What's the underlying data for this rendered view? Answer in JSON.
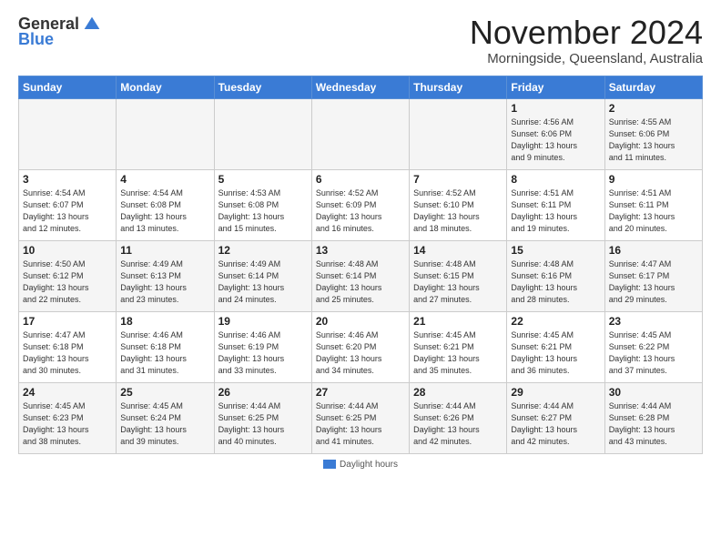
{
  "logo": {
    "general": "General",
    "blue": "Blue"
  },
  "title": "November 2024",
  "location": "Morningside, Queensland, Australia",
  "days_header": [
    "Sunday",
    "Monday",
    "Tuesday",
    "Wednesday",
    "Thursday",
    "Friday",
    "Saturday"
  ],
  "weeks": [
    [
      {
        "day": "",
        "info": ""
      },
      {
        "day": "",
        "info": ""
      },
      {
        "day": "",
        "info": ""
      },
      {
        "day": "",
        "info": ""
      },
      {
        "day": "",
        "info": ""
      },
      {
        "day": "1",
        "info": "Sunrise: 4:56 AM\nSunset: 6:06 PM\nDaylight: 13 hours\nand 9 minutes."
      },
      {
        "day": "2",
        "info": "Sunrise: 4:55 AM\nSunset: 6:06 PM\nDaylight: 13 hours\nand 11 minutes."
      }
    ],
    [
      {
        "day": "3",
        "info": "Sunrise: 4:54 AM\nSunset: 6:07 PM\nDaylight: 13 hours\nand 12 minutes."
      },
      {
        "day": "4",
        "info": "Sunrise: 4:54 AM\nSunset: 6:08 PM\nDaylight: 13 hours\nand 13 minutes."
      },
      {
        "day": "5",
        "info": "Sunrise: 4:53 AM\nSunset: 6:08 PM\nDaylight: 13 hours\nand 15 minutes."
      },
      {
        "day": "6",
        "info": "Sunrise: 4:52 AM\nSunset: 6:09 PM\nDaylight: 13 hours\nand 16 minutes."
      },
      {
        "day": "7",
        "info": "Sunrise: 4:52 AM\nSunset: 6:10 PM\nDaylight: 13 hours\nand 18 minutes."
      },
      {
        "day": "8",
        "info": "Sunrise: 4:51 AM\nSunset: 6:11 PM\nDaylight: 13 hours\nand 19 minutes."
      },
      {
        "day": "9",
        "info": "Sunrise: 4:51 AM\nSunset: 6:11 PM\nDaylight: 13 hours\nand 20 minutes."
      }
    ],
    [
      {
        "day": "10",
        "info": "Sunrise: 4:50 AM\nSunset: 6:12 PM\nDaylight: 13 hours\nand 22 minutes."
      },
      {
        "day": "11",
        "info": "Sunrise: 4:49 AM\nSunset: 6:13 PM\nDaylight: 13 hours\nand 23 minutes."
      },
      {
        "day": "12",
        "info": "Sunrise: 4:49 AM\nSunset: 6:14 PM\nDaylight: 13 hours\nand 24 minutes."
      },
      {
        "day": "13",
        "info": "Sunrise: 4:48 AM\nSunset: 6:14 PM\nDaylight: 13 hours\nand 25 minutes."
      },
      {
        "day": "14",
        "info": "Sunrise: 4:48 AM\nSunset: 6:15 PM\nDaylight: 13 hours\nand 27 minutes."
      },
      {
        "day": "15",
        "info": "Sunrise: 4:48 AM\nSunset: 6:16 PM\nDaylight: 13 hours\nand 28 minutes."
      },
      {
        "day": "16",
        "info": "Sunrise: 4:47 AM\nSunset: 6:17 PM\nDaylight: 13 hours\nand 29 minutes."
      }
    ],
    [
      {
        "day": "17",
        "info": "Sunrise: 4:47 AM\nSunset: 6:18 PM\nDaylight: 13 hours\nand 30 minutes."
      },
      {
        "day": "18",
        "info": "Sunrise: 4:46 AM\nSunset: 6:18 PM\nDaylight: 13 hours\nand 31 minutes."
      },
      {
        "day": "19",
        "info": "Sunrise: 4:46 AM\nSunset: 6:19 PM\nDaylight: 13 hours\nand 33 minutes."
      },
      {
        "day": "20",
        "info": "Sunrise: 4:46 AM\nSunset: 6:20 PM\nDaylight: 13 hours\nand 34 minutes."
      },
      {
        "day": "21",
        "info": "Sunrise: 4:45 AM\nSunset: 6:21 PM\nDaylight: 13 hours\nand 35 minutes."
      },
      {
        "day": "22",
        "info": "Sunrise: 4:45 AM\nSunset: 6:21 PM\nDaylight: 13 hours\nand 36 minutes."
      },
      {
        "day": "23",
        "info": "Sunrise: 4:45 AM\nSunset: 6:22 PM\nDaylight: 13 hours\nand 37 minutes."
      }
    ],
    [
      {
        "day": "24",
        "info": "Sunrise: 4:45 AM\nSunset: 6:23 PM\nDaylight: 13 hours\nand 38 minutes."
      },
      {
        "day": "25",
        "info": "Sunrise: 4:45 AM\nSunset: 6:24 PM\nDaylight: 13 hours\nand 39 minutes."
      },
      {
        "day": "26",
        "info": "Sunrise: 4:44 AM\nSunset: 6:25 PM\nDaylight: 13 hours\nand 40 minutes."
      },
      {
        "day": "27",
        "info": "Sunrise: 4:44 AM\nSunset: 6:25 PM\nDaylight: 13 hours\nand 41 minutes."
      },
      {
        "day": "28",
        "info": "Sunrise: 4:44 AM\nSunset: 6:26 PM\nDaylight: 13 hours\nand 42 minutes."
      },
      {
        "day": "29",
        "info": "Sunrise: 4:44 AM\nSunset: 6:27 PM\nDaylight: 13 hours\nand 42 minutes."
      },
      {
        "day": "30",
        "info": "Sunrise: 4:44 AM\nSunset: 6:28 PM\nDaylight: 13 hours\nand 43 minutes."
      }
    ]
  ],
  "footer": {
    "legend_label": "Daylight hours"
  },
  "colors": {
    "header_bg": "#3a7bd5",
    "accent": "#3a7bd5"
  }
}
